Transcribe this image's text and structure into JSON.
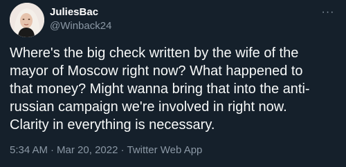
{
  "author": {
    "display_name": "JuliesBac",
    "handle": "@Winback24",
    "avatar_icon": "profile-photo"
  },
  "tweet": {
    "text_lines": [
      "Where's the big check written by the wife of the",
      "mayor of Moscow right now? What happened to",
      "that money? Might wanna bring that into the anti-",
      "russian campaign we're involved in right now.",
      "Clarity in everything is necessary."
    ],
    "time": "5:34 AM",
    "date": "Mar 20, 2022",
    "source": "Twitter Web App",
    "separator": "·"
  },
  "menu": {
    "more_icon": "more-options-icon",
    "more_glyph": "···"
  },
  "colors": {
    "background": "#15202b",
    "primary_text": "#f7f9f9",
    "secondary_text": "#8b98a5"
  }
}
